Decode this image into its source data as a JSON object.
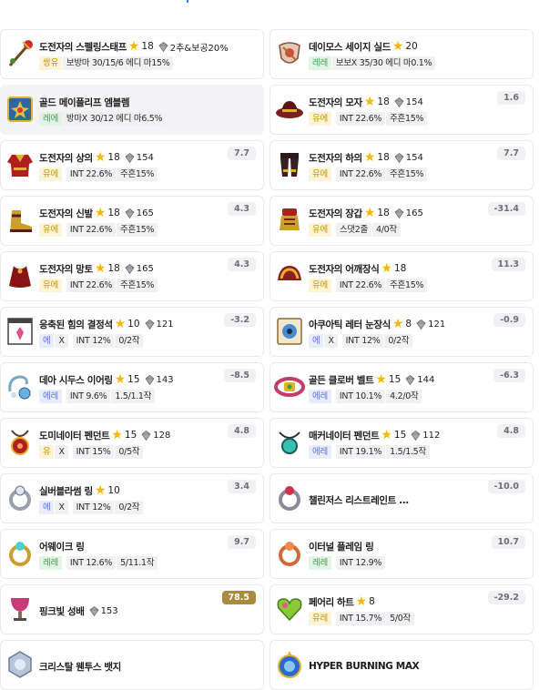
{
  "items": [
    {
      "name": "도전자의 스펠링스태프",
      "stars": "18",
      "gem": "2추&보공20%",
      "tags": [
        {
          "t": "쌍유",
          "c": "y"
        },
        {
          "t": "보방마 30/15/6 에디 마15%"
        }
      ],
      "score": "",
      "icon": "staff"
    },
    {
      "name": "데이모스 세이지 실드",
      "stars": "20",
      "gem": "",
      "tags": [
        {
          "t": "레레",
          "c": "g"
        },
        {
          "t": "보보X 35/30 에디 마0.1%"
        }
      ],
      "score": "",
      "icon": "shield"
    },
    {
      "name": "골드 메이플리프 엠블렘",
      "stars": "",
      "gem": "",
      "tags": [
        {
          "t": "레에",
          "c": "g"
        },
        {
          "t": "방마X 30/12 에디 마6.5%"
        }
      ],
      "score": "",
      "icon": "emblem",
      "selected": true
    },
    {
      "name": "도전자의 모자",
      "stars": "18",
      "gem": "154",
      "tags": [
        {
          "t": "유에",
          "c": "y"
        },
        {
          "t": "INT 22.6%",
          "gap": true
        },
        {
          "t": "주흔15%"
        }
      ],
      "score": "1.6",
      "icon": "hat"
    },
    {
      "name": "도전자의 상의",
      "stars": "18",
      "gem": "154",
      "tags": [
        {
          "t": "유에",
          "c": "y"
        },
        {
          "t": "INT 22.6%",
          "gap": true
        },
        {
          "t": "주흔15%"
        }
      ],
      "score": "7.7",
      "icon": "top"
    },
    {
      "name": "도전자의 하의",
      "stars": "18",
      "gem": "154",
      "tags": [
        {
          "t": "유에",
          "c": "y"
        },
        {
          "t": "INT 22.6%",
          "gap": true
        },
        {
          "t": "주흔15%"
        }
      ],
      "score": "7.7",
      "icon": "pants"
    },
    {
      "name": "도전자의 신발",
      "stars": "18",
      "gem": "165",
      "tags": [
        {
          "t": "유에",
          "c": "y"
        },
        {
          "t": "INT 22.6%",
          "gap": true
        },
        {
          "t": "주흔15%"
        }
      ],
      "score": "4.3",
      "icon": "shoes"
    },
    {
      "name": "도전자의 장갑",
      "stars": "18",
      "gem": "165",
      "tags": [
        {
          "t": "유에",
          "c": "y"
        },
        {
          "t": "스댓2줄",
          "gap": true
        },
        {
          "t": "4/0작"
        }
      ],
      "score": "-31.4",
      "icon": "gloves"
    },
    {
      "name": "도전자의 망토",
      "stars": "18",
      "gem": "165",
      "tags": [
        {
          "t": "유에",
          "c": "y"
        },
        {
          "t": "INT 22.6%",
          "gap": true
        },
        {
          "t": "주흔15%"
        }
      ],
      "score": "4.3",
      "icon": "cape"
    },
    {
      "name": "도전자의 어깨장식",
      "stars": "18",
      "gem": "",
      "tags": [
        {
          "t": "유에",
          "c": "y"
        },
        {
          "t": "INT 22.6%",
          "gap": true
        },
        {
          "t": "주흔15%"
        }
      ],
      "score": "11.3",
      "icon": "shoulder"
    },
    {
      "name": "응축된 힘의 결정석",
      "stars": "10",
      "gem": "121",
      "tags": [
        {
          "t": "에",
          "c": "b"
        },
        {
          "t": "X"
        },
        {
          "t": "INT 12%",
          "gap": true
        },
        {
          "t": "0/2작"
        }
      ],
      "score": "-3.2",
      "icon": "crystal"
    },
    {
      "name": "아쿠아틱 레터 눈장식",
      "stars": "8",
      "gem": "121",
      "tags": [
        {
          "t": "에",
          "c": "b"
        },
        {
          "t": "X"
        },
        {
          "t": "INT 12%",
          "gap": true
        },
        {
          "t": "0/2작"
        }
      ],
      "score": "-0.9",
      "icon": "eye"
    },
    {
      "name": "데아 시두스 이어링",
      "stars": "15",
      "gem": "143",
      "tags": [
        {
          "t": "에레",
          "c": "b"
        },
        {
          "t": "INT 9.6%",
          "gap": true
        },
        {
          "t": "1.5/1.1작"
        }
      ],
      "score": "-8.5",
      "icon": "earring"
    },
    {
      "name": "골든 클로버 벨트",
      "stars": "15",
      "gem": "144",
      "tags": [
        {
          "t": "에레",
          "c": "b"
        },
        {
          "t": "INT 10.1%",
          "gap": true
        },
        {
          "t": "4.2/0작"
        }
      ],
      "score": "-6.3",
      "icon": "belt"
    },
    {
      "name": "도미네이터 펜던트",
      "stars": "15",
      "gem": "128",
      "tags": [
        {
          "t": "유",
          "c": "y"
        },
        {
          "t": "X"
        },
        {
          "t": "INT 15%",
          "gap": true
        },
        {
          "t": "0/5작"
        }
      ],
      "score": "4.8",
      "icon": "pendant"
    },
    {
      "name": "매커네이터 펜던트",
      "stars": "15",
      "gem": "112",
      "tags": [
        {
          "t": "에레",
          "c": "b"
        },
        {
          "t": "INT 19.1%",
          "gap": true
        },
        {
          "t": "1.5/1.5작"
        }
      ],
      "score": "4.8",
      "icon": "pendant2"
    },
    {
      "name": "실버블라썸 링",
      "stars": "10",
      "gem": "",
      "tags": [
        {
          "t": "에",
          "c": "b"
        },
        {
          "t": "X"
        },
        {
          "t": "INT 12%",
          "gap": true
        },
        {
          "t": "0/2작"
        }
      ],
      "score": "3.4",
      "icon": "ring1"
    },
    {
      "name": "챌린저스 리스트레인트 ...",
      "stars": "",
      "gem": "",
      "tags": [],
      "score": "-10.0",
      "icon": "ring2",
      "single": true
    },
    {
      "name": "어웨이크 링",
      "stars": "",
      "gem": "",
      "tags": [
        {
          "t": "레레",
          "c": "g"
        },
        {
          "t": "INT 12.6%",
          "gap": true
        },
        {
          "t": "5/11.1작"
        }
      ],
      "score": "9.7",
      "icon": "ring3"
    },
    {
      "name": "이터널 플레임 링",
      "stars": "",
      "gem": "",
      "tags": [
        {
          "t": "레레",
          "c": "g"
        },
        {
          "t": "INT 12.9%",
          "gap": true
        }
      ],
      "score": "10.7",
      "icon": "ring4"
    },
    {
      "name": "핑크빛 성배",
      "stars": "",
      "gem": "153",
      "tags": [],
      "score": "78.5",
      "scoreGold": true,
      "icon": "cup",
      "single": true
    },
    {
      "name": "페어리 하트",
      "stars": "8",
      "gem": "",
      "tags": [
        {
          "t": "유레",
          "c": "y"
        },
        {
          "t": "INT 15.7%",
          "gap": true
        },
        {
          "t": "5/0작"
        }
      ],
      "score": "-29.2",
      "icon": "heart"
    },
    {
      "name": "크리스탈 웬투스 뱃지",
      "stars": "",
      "gem": "",
      "tags": [],
      "score": "",
      "icon": "badge",
      "single": true
    },
    {
      "name": "HYPER BURNING MAX",
      "stars": "",
      "gem": "",
      "tags": [],
      "score": "",
      "icon": "hyper",
      "single": true
    }
  ],
  "colors": {
    "star": "#f5b800",
    "tag_legendary": "#4d9a5a",
    "tag_unique": "#c2960a",
    "tag_epic": "#5a74c9",
    "score_gold": "#a98a3e"
  }
}
